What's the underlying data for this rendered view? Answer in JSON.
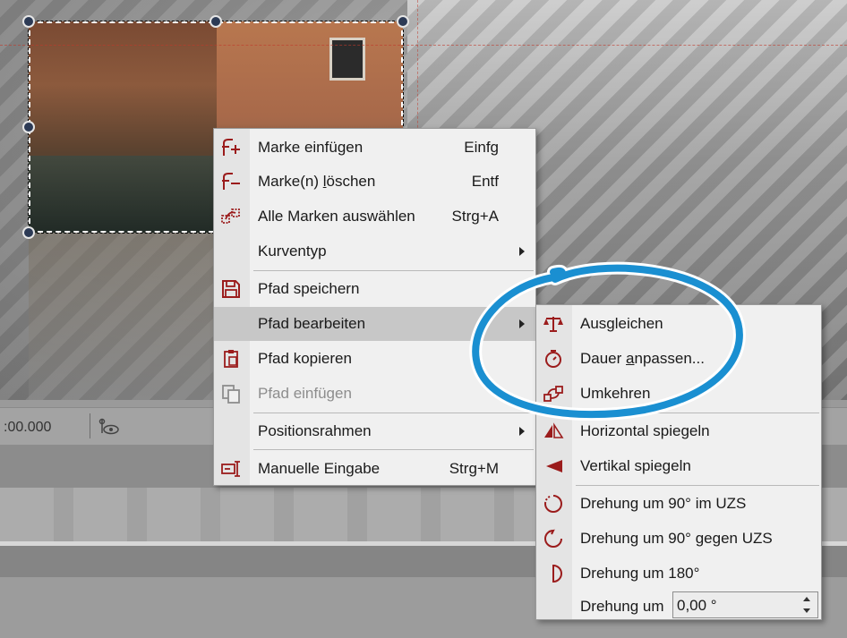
{
  "timeline": {
    "time": ":00.000"
  },
  "context_menu": {
    "items": [
      {
        "label": "Marke einfügen",
        "shortcut": "Einfg"
      },
      {
        "label": "Marke(n) ",
        "label_u": "l",
        "label_rest": "öschen",
        "shortcut": "Entf"
      },
      {
        "label": "Alle Marken auswählen",
        "shortcut": "Strg+A"
      },
      {
        "label": "Kurventyp"
      },
      {
        "label": "Pfad speichern"
      },
      {
        "label": "Pfad bearbeiten"
      },
      {
        "label": "Pfad kopieren"
      },
      {
        "label": "Pfad einfügen"
      },
      {
        "label": "Positionsrahmen"
      },
      {
        "label": "Manuelle Eingabe",
        "shortcut": "Strg+M"
      }
    ]
  },
  "submenu": {
    "items": [
      {
        "label": "Ausgleichen"
      },
      {
        "label": "Dauer ",
        "label_u": "a",
        "label_rest": "npassen..."
      },
      {
        "label": "Umkehren"
      },
      {
        "label": "Horizontal spiegeln"
      },
      {
        "label": "Vertikal spiegeln"
      },
      {
        "label": "Drehung um 90° im UZS"
      },
      {
        "label": "Drehung um 90° gegen UZS"
      },
      {
        "label": "Drehung um 180°"
      },
      {
        "label": "Drehung um",
        "value": "0,00 °"
      }
    ]
  },
  "colors": {
    "icon_red": "#9b1c1c",
    "annotation_blue": "#1a8fd1",
    "highlight": "#c7c7c7"
  }
}
